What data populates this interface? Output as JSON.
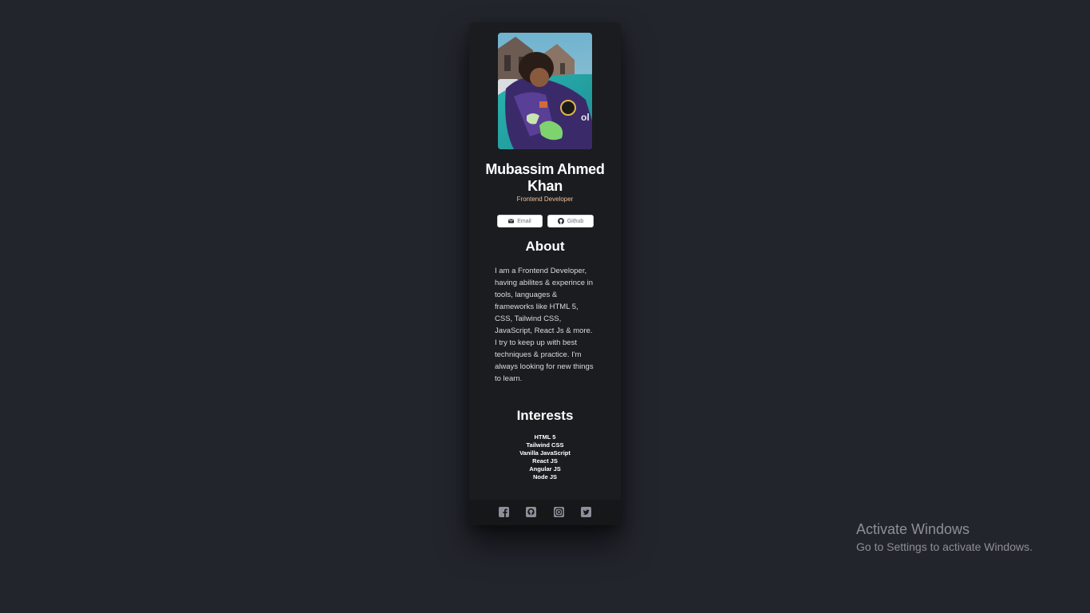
{
  "profile": {
    "name": "Mubassim Ahmed Khan",
    "role": "Frontend Developer",
    "photo_alt": "profile-photo"
  },
  "buttons": {
    "email_label": "Email",
    "github_label": "Github"
  },
  "about": {
    "heading": "About",
    "text": "I am a Frontend Developer, having abilites & experince in tools, languages & frameworks like HTML 5, CSS, Tailwind CSS, JavaScript, React Js & more. I try to keep up with best techniques & practice. I'm always looking for new things to learn."
  },
  "interests": {
    "heading": "Interests",
    "items": [
      "HTML 5",
      "Tailwind CSS",
      "Vanilla JavaScript",
      "React JS",
      "Angular JS",
      "Node JS"
    ]
  },
  "footer": {
    "icons": [
      "facebook-icon",
      "github-icon",
      "instagram-icon",
      "twitter-icon"
    ]
  },
  "windows_watermark": {
    "title": "Activate Windows",
    "subtitle": "Go to Settings to activate Windows."
  },
  "colors": {
    "background": "#23252d",
    "card": "#1b1c20",
    "footer": "#161719",
    "role_accent": "#f3bf99"
  }
}
